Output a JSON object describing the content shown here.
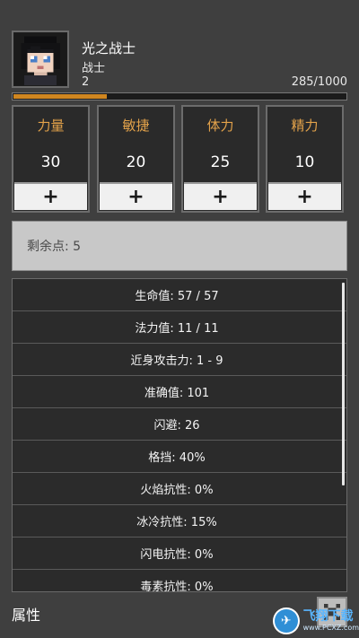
{
  "character": {
    "name": "光之战士",
    "class": "战士",
    "level": "2",
    "exp_text": "285/1000",
    "exp_fraction": 0.285,
    "avatar": "warrior-portrait-icon"
  },
  "stats": [
    {
      "label": "力量",
      "value": "30",
      "button": "+"
    },
    {
      "label": "敏捷",
      "value": "20",
      "button": "+"
    },
    {
      "label": "体力",
      "value": "25",
      "button": "+"
    },
    {
      "label": "精力",
      "value": "10",
      "button": "+"
    }
  ],
  "remaining_points": "剩余点: 5",
  "attributes": [
    "生命值: 57 / 57",
    "法力值: 11 / 11",
    "近身攻击力: 1 - 9",
    "准确值: 101",
    "闪避: 26",
    "格挡: 40%",
    "火焰抗性: 0%",
    "冰冷抗性: 15%",
    "闪电抗性: 0%",
    "毒素抗性: 0%"
  ],
  "bottom": {
    "title": "属性",
    "close_icon": "close-x-icon"
  },
  "watermark": {
    "name": "飞翔下载",
    "url": "www.PCXZ.com"
  },
  "colors": {
    "accent_orange": "#e3a24a",
    "exp_fill": "#d08620",
    "panel_bg": "#2a2a2a",
    "page_bg": "#3f3f3f"
  }
}
